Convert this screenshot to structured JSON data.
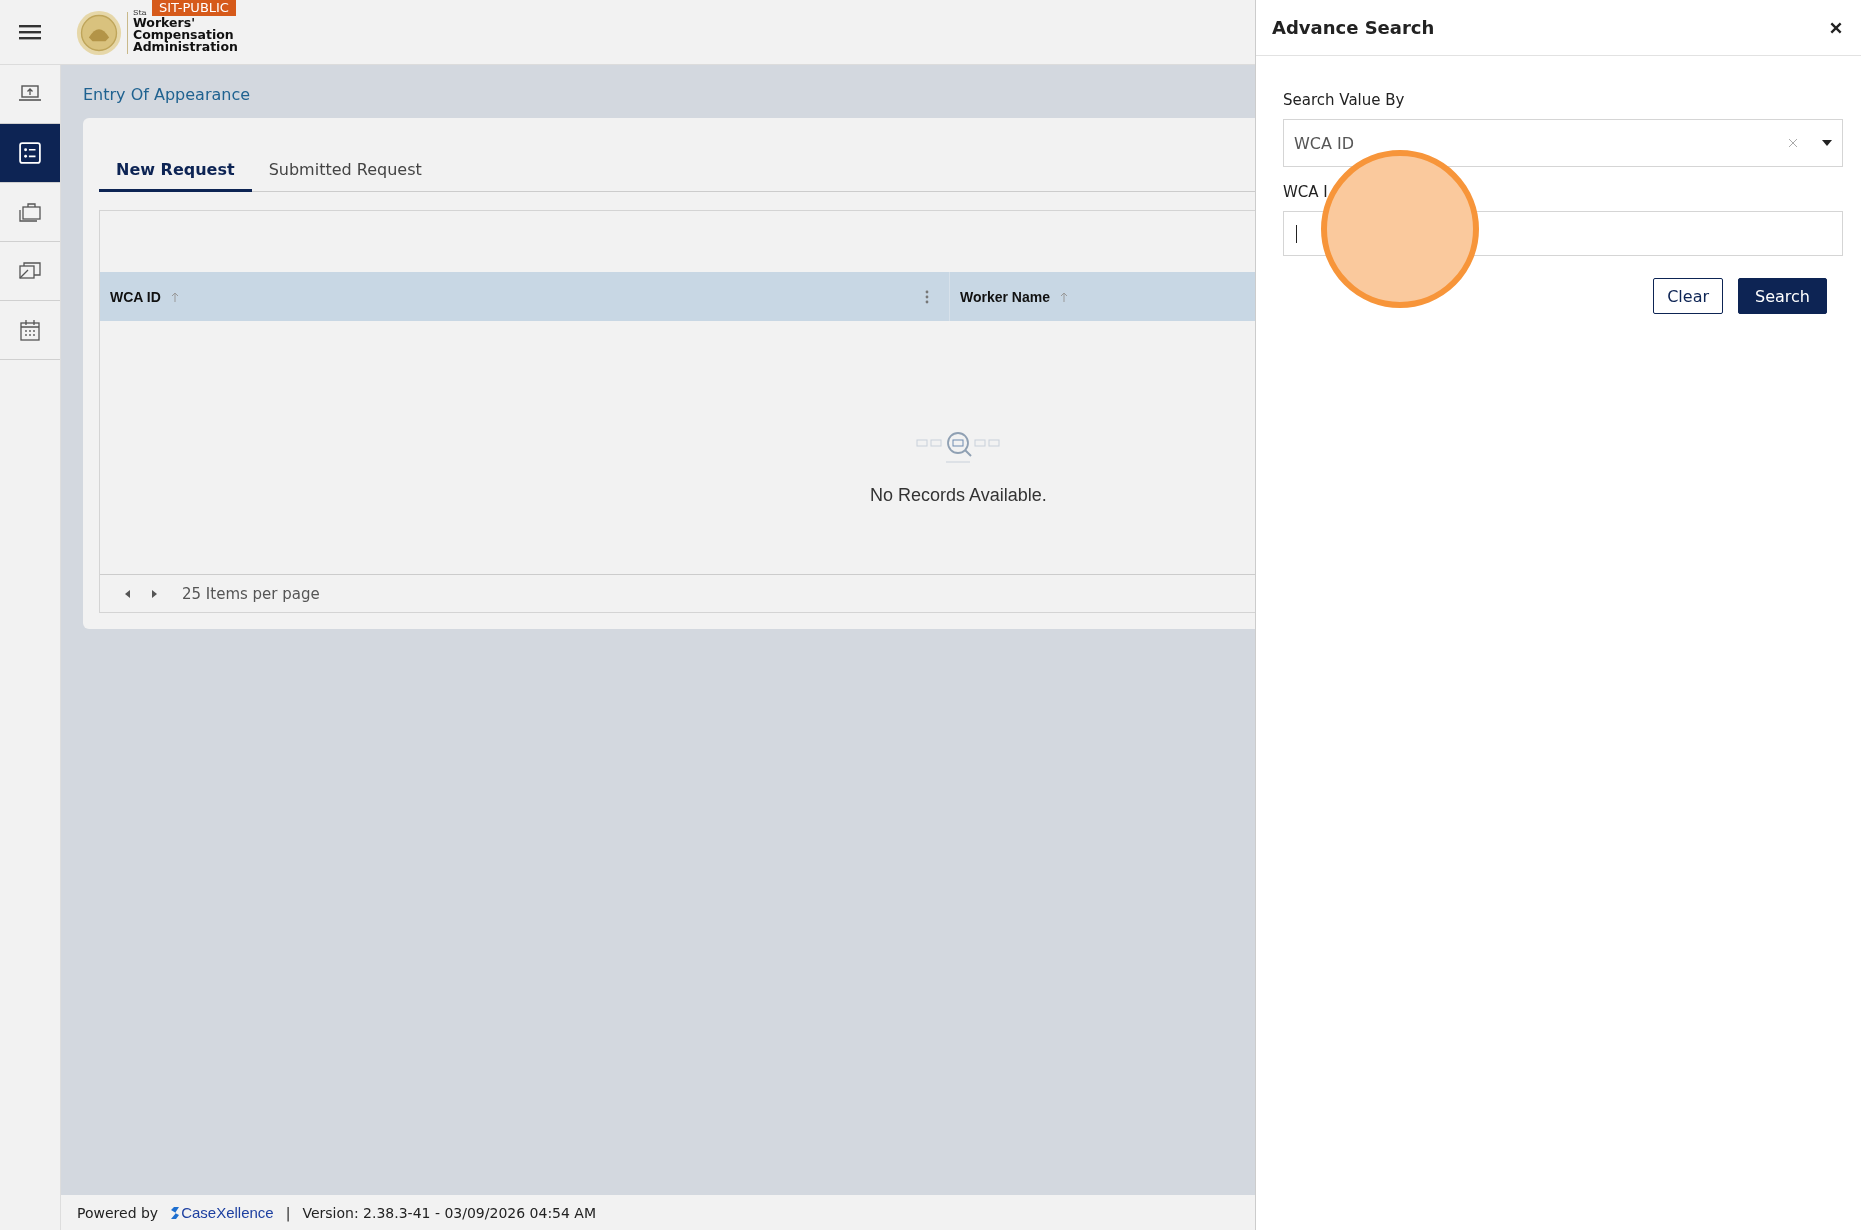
{
  "header": {
    "badge": "SIT-PUBLIC",
    "logo_small": "Sta",
    "logo_lines": [
      "Workers'",
      "Compensation",
      "Administration"
    ]
  },
  "sidebar": {
    "items": [
      {
        "kind": "upload",
        "selected": false
      },
      {
        "kind": "list",
        "selected": true
      },
      {
        "kind": "briefcase",
        "selected": false
      },
      {
        "kind": "cards",
        "selected": false
      },
      {
        "kind": "calendar",
        "selected": false
      }
    ]
  },
  "breadcrumb": "Entry Of Appearance",
  "tabs": [
    {
      "label": "New Request",
      "selected": true
    },
    {
      "label": "Submitted Request",
      "selected": false
    }
  ],
  "table": {
    "columns": [
      {
        "label": "WCA ID"
      },
      {
        "label": "Worker Name"
      }
    ],
    "empty_message": "No Records Available.",
    "pager": "25 Items per page"
  },
  "footer": {
    "powered_by": "Powered by",
    "brand": "CaseXellence",
    "separator": "|",
    "version": "Version: 2.38.3-41 - 03/09/2026 04:54 AM"
  },
  "advance_search": {
    "title": "Advance Search",
    "search_by_label": "Search Value By",
    "search_by_value": "WCA ID",
    "field_label": "WCA I",
    "buttons": [
      "Clear",
      "Search"
    ]
  }
}
